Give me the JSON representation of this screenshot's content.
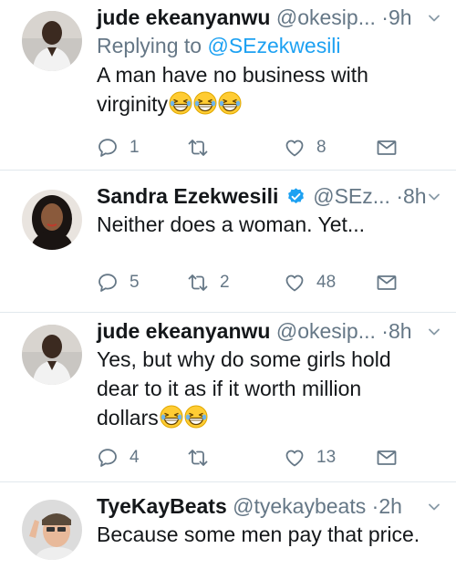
{
  "colors": {
    "accent": "#1da1f2",
    "muted": "#657786",
    "verified": "#1da1f2",
    "text": "#14171a"
  },
  "tweets": [
    {
      "name": "jude ekeanyanwu",
      "handle": "@okesip...",
      "dot": "·",
      "time": "9h",
      "replying_prefix": "Replying to ",
      "replying_mention": "@SEzekwesili",
      "text_line1": "A man have no business with",
      "text_line2": "virginity",
      "emoji": [
        "grinning-squint-emoji",
        "grinning-squint-emoji",
        "grinning-squint-emoji"
      ],
      "replies": "1",
      "retweets": "",
      "likes": "8"
    },
    {
      "name": "Sandra Ezekwesili",
      "verified": true,
      "handle": "@SEz...",
      "dot": "·",
      "time": "8h",
      "text": "Neither does a woman. Yet...",
      "replies": "5",
      "retweets": "2",
      "likes": "48"
    },
    {
      "name": "jude ekeanyanwu",
      "handle": "@okesip...",
      "dot": "·",
      "time": "8h",
      "text_line1": "Yes, but why do some girls hold",
      "text_line2": "dear to it as if it worth million",
      "text_line3": "dollars",
      "emoji": [
        "grinning-squint-emoji",
        "grinning-squint-emoji"
      ],
      "replies": "4",
      "retweets": "",
      "likes": "13"
    },
    {
      "name": "TyeKayBeats",
      "handle": "@tyekaybeats",
      "dot": "·",
      "time": "2h",
      "text": "Because some men pay that price."
    }
  ]
}
